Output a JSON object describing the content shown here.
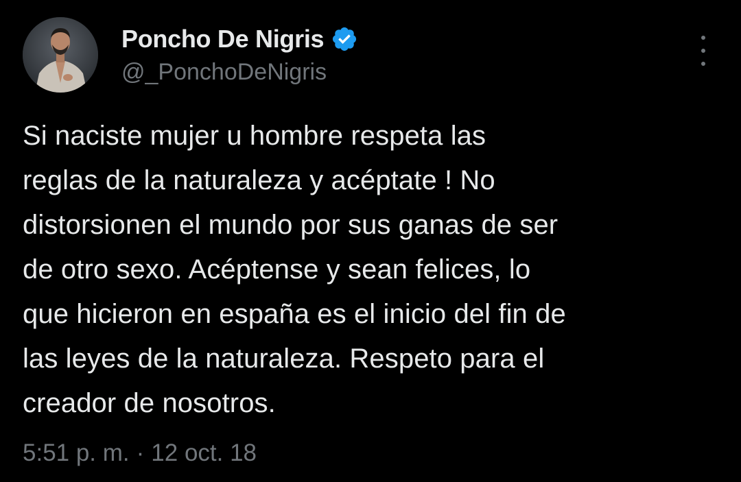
{
  "tweet": {
    "author": {
      "display_name": "Poncho De Nigris",
      "handle": "@_PonchoDeNigris",
      "verified": true,
      "avatar_icon": "profile-photo"
    },
    "more_icon": "more-options-icon",
    "text": "Si naciste mujer u hombre respeta las\nreglas de la naturaleza y acéptate ! No\ndistorsionen el mundo por sus ganas de ser\nde otro sexo. Acéptense y sean felices, lo\nque hicieron en españa es el inicio del fin de\nlas leyes de la naturaleza. Respeto para el\ncreador de nosotros.",
    "time": "5:51 p. m.",
    "separator": "·",
    "date": "12 oct. 18"
  },
  "colors": {
    "background": "#000000",
    "primary_text": "#e7e9ea",
    "secondary_text": "#71767b",
    "verified_blue": "#1d9bf0"
  }
}
